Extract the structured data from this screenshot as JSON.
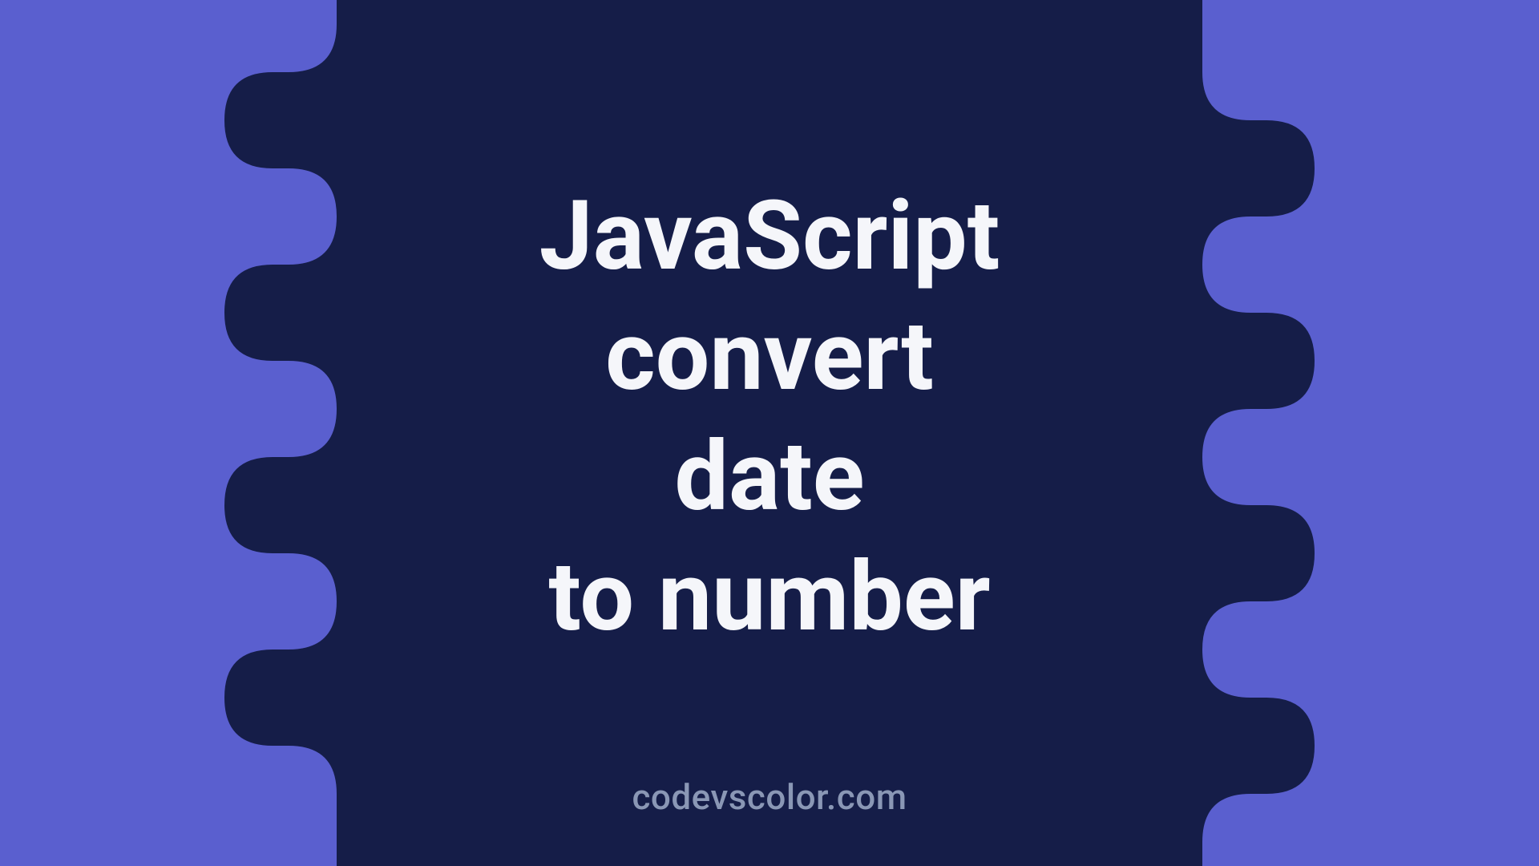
{
  "title_lines": [
    "JavaScript",
    "convert",
    "date",
    "to number"
  ],
  "footer": "codevscolor.com",
  "colors": {
    "background": "#5a5fcf",
    "blob": "#151d48",
    "text": "#f5f6fa",
    "footer": "#8a97b5"
  }
}
